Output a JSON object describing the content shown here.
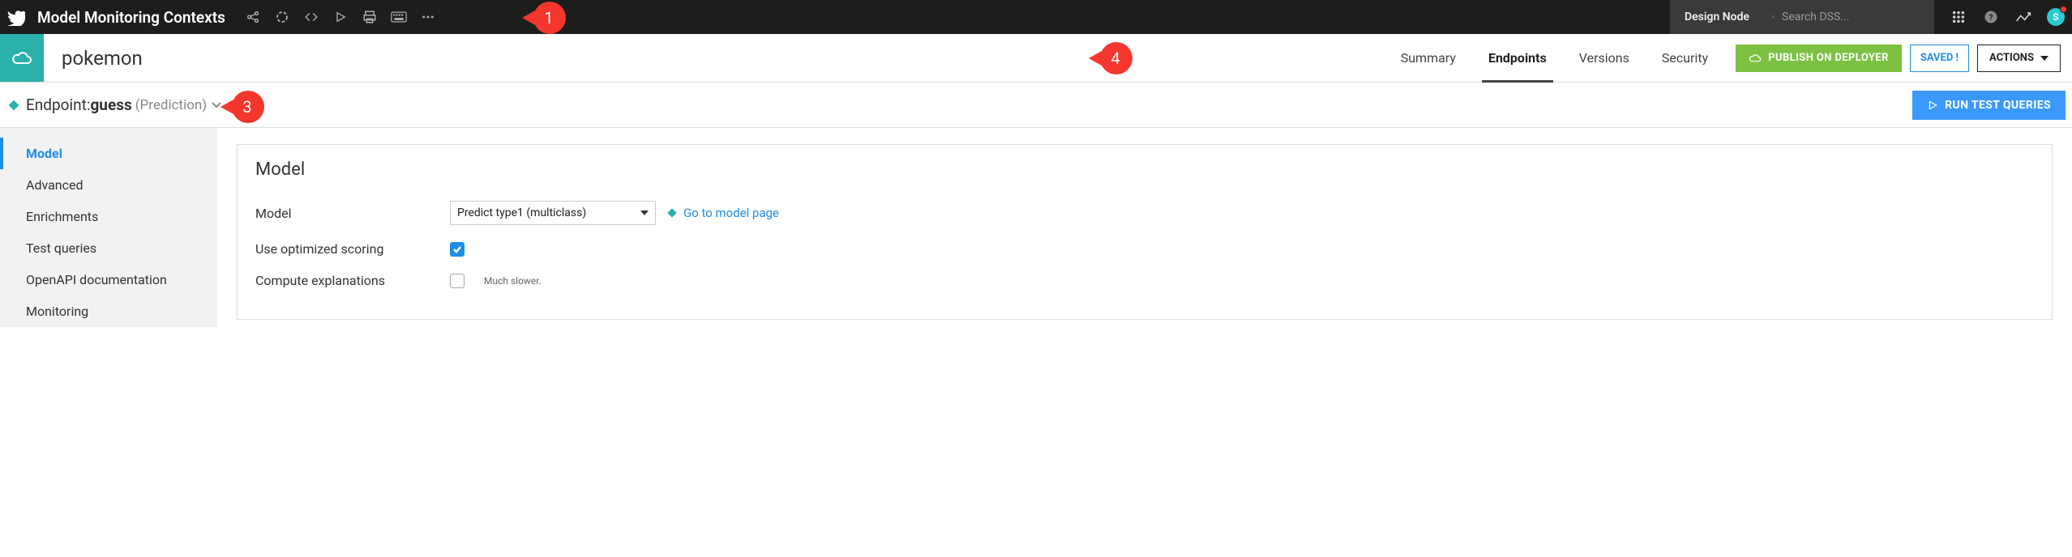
{
  "topbar": {
    "title": "Model Monitoring Contexts",
    "design_node_label": "Design Node",
    "search_placeholder": "Search DSS...",
    "avatar_initial": "S"
  },
  "project": {
    "name": "pokemon",
    "tabs": [
      {
        "label": "Summary",
        "active": false
      },
      {
        "label": "Endpoints",
        "active": true
      },
      {
        "label": "Versions",
        "active": false
      },
      {
        "label": "Security",
        "active": false
      }
    ],
    "publish_label": "PUBLISH ON DEPLOYER",
    "saved_label": "SAVED !",
    "actions_label": "ACTIONS"
  },
  "endpoint": {
    "prefix": "Endpoint: ",
    "name": "guess",
    "type": "(Prediction)",
    "run_label": "RUN TEST QUERIES"
  },
  "sidebar": {
    "items": [
      {
        "label": "Model",
        "active": true
      },
      {
        "label": "Advanced",
        "active": false
      },
      {
        "label": "Enrichments",
        "active": false
      },
      {
        "label": "Test queries",
        "active": false
      },
      {
        "label": "OpenAPI documentation",
        "active": false
      },
      {
        "label": "Monitoring",
        "active": false
      }
    ]
  },
  "panel": {
    "title": "Model",
    "model_label": "Model",
    "model_selected": "Predict type1 (multiclass)",
    "go_link_label": "Go to model page",
    "optimized_label": "Use optimized scoring",
    "optimized_checked": true,
    "explanations_label": "Compute explanations",
    "explanations_checked": false,
    "explanations_helper": "Much slower."
  },
  "callouts": {
    "one": "1",
    "three": "3",
    "four": "4"
  }
}
